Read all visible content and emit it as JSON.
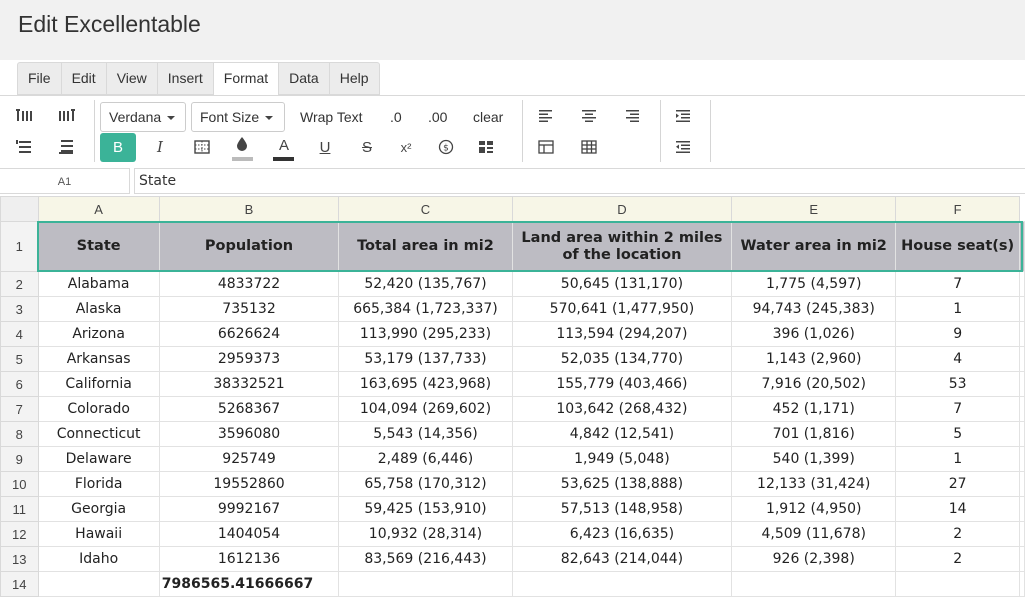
{
  "app": {
    "title": "Edit Excellentable"
  },
  "menu": {
    "items": [
      "File",
      "Edit",
      "View",
      "Insert",
      "Format",
      "Data",
      "Help"
    ],
    "active": "Format"
  },
  "toolbar": {
    "font_family": "Verdana",
    "font_size": "Font Size",
    "wrap_text": "Wrap Text",
    "decimal_one": ".0",
    "decimal_two": ".00",
    "clear": "clear",
    "bold": "B",
    "italic": "I",
    "text_color_letter": "A",
    "underline": "U",
    "strike": "S",
    "superscript": "x²",
    "currency": "$",
    "accent_color": "#3bb398",
    "fill_color_swatch": "#bbbbbb",
    "text_color_swatch": "#333333"
  },
  "formula_bar": {
    "cell_ref": "A1",
    "value": "State"
  },
  "grid": {
    "columns": [
      "A",
      "B",
      "C",
      "D",
      "E",
      "F"
    ],
    "header_row": {
      "num": "1",
      "cells": [
        "State",
        "Population",
        "Total area in mi2",
        "Land area within 2 miles of the location",
        "Water area in mi2",
        "House seat(s)"
      ]
    },
    "rows": [
      {
        "num": "2",
        "cells": [
          "Alabama",
          "4833722",
          "52,420 (135,767)",
          "50,645 (131,170)",
          "1,775 (4,597)",
          "7"
        ]
      },
      {
        "num": "3",
        "cells": [
          "Alaska",
          "735132",
          "665,384 (1,723,337)",
          "570,641 (1,477,950)",
          "94,743 (245,383)",
          "1"
        ]
      },
      {
        "num": "4",
        "cells": [
          "Arizona",
          "6626624",
          "113,990 (295,233)",
          "113,594 (294,207)",
          "396 (1,026)",
          "9"
        ]
      },
      {
        "num": "5",
        "cells": [
          "Arkansas",
          "2959373",
          "53,179 (137,733)",
          "52,035 (134,770)",
          "1,143 (2,960)",
          "4"
        ]
      },
      {
        "num": "6",
        "cells": [
          "California",
          "38332521",
          "163,695 (423,968)",
          "155,779 (403,466)",
          "7,916 (20,502)",
          "53"
        ]
      },
      {
        "num": "7",
        "cells": [
          "Colorado",
          "5268367",
          "104,094 (269,602)",
          "103,642 (268,432)",
          "452 (1,171)",
          "7"
        ]
      },
      {
        "num": "8",
        "cells": [
          "Connecticut",
          "3596080",
          "5,543 (14,356)",
          "4,842 (12,541)",
          "701 (1,816)",
          "5"
        ]
      },
      {
        "num": "9",
        "cells": [
          "Delaware",
          "925749",
          "2,489 (6,446)",
          "1,949 (5,048)",
          "540 (1,399)",
          "1"
        ]
      },
      {
        "num": "10",
        "cells": [
          "Florida",
          "19552860",
          "65,758 (170,312)",
          "53,625 (138,888)",
          "12,133 (31,424)",
          "27"
        ]
      },
      {
        "num": "11",
        "cells": [
          "Georgia",
          "9992167",
          "59,425 (153,910)",
          "57,513 (148,958)",
          "1,912 (4,950)",
          "14"
        ]
      },
      {
        "num": "12",
        "cells": [
          "Hawaii",
          "1404054",
          "10,932 (28,314)",
          "6,423 (16,635)",
          "4,509 (11,678)",
          "2"
        ]
      },
      {
        "num": "13",
        "cells": [
          "Idaho",
          "1612136",
          "83,569 (216,443)",
          "82,643 (214,044)",
          "926 (2,398)",
          "2"
        ]
      },
      {
        "num": "14",
        "cells": [
          "",
          "7986565.41666667",
          "",
          "",
          "",
          ""
        ]
      }
    ]
  }
}
